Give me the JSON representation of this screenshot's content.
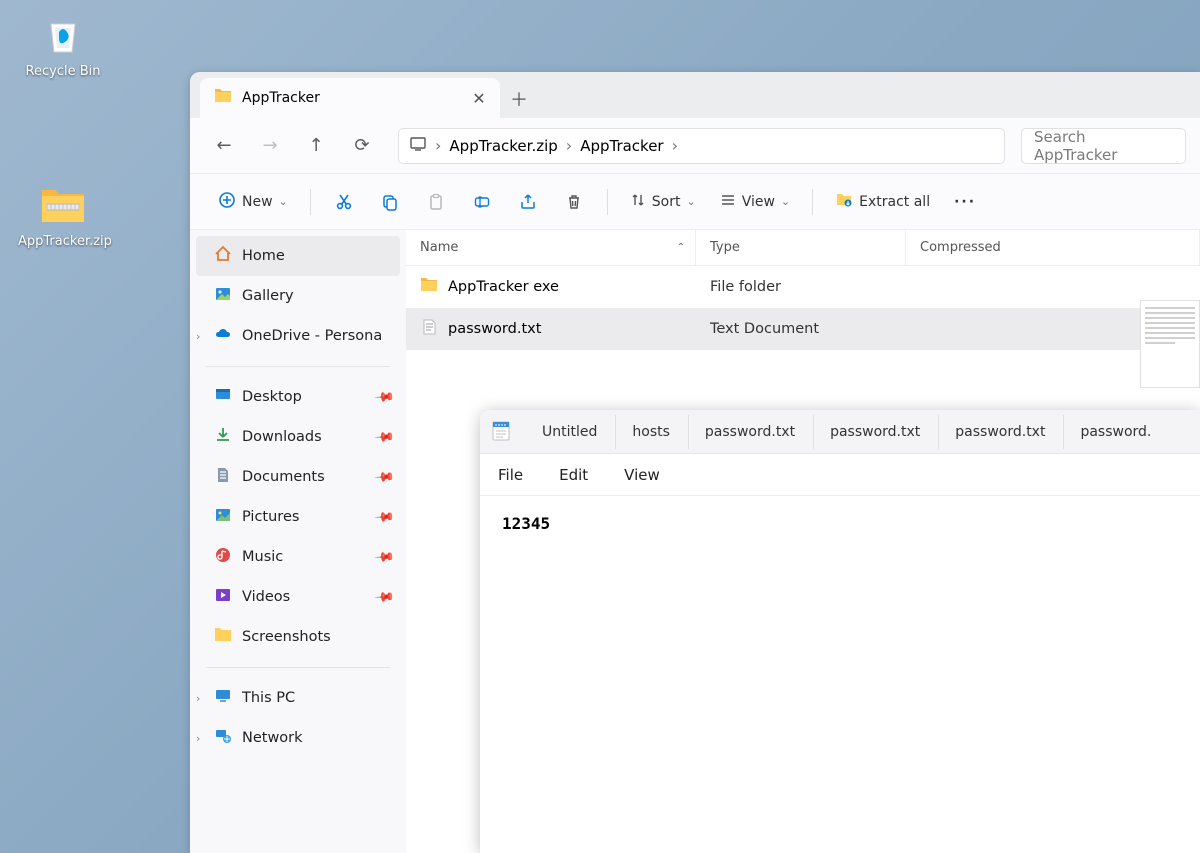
{
  "desktop": {
    "icons": [
      {
        "label": "Recycle Bin"
      },
      {
        "label": "AppTracker.zip"
      }
    ]
  },
  "explorer": {
    "tab_title": "AppTracker",
    "breadcrumb": [
      "AppTracker.zip",
      "AppTracker"
    ],
    "search_placeholder": "Search AppTracker",
    "toolbar": {
      "new": "New",
      "sort": "Sort",
      "view": "View",
      "extract": "Extract all"
    },
    "sidebar": {
      "home": "Home",
      "gallery": "Gallery",
      "onedrive": "OneDrive - Persona",
      "desktop": "Desktop",
      "downloads": "Downloads",
      "documents": "Documents",
      "pictures": "Pictures",
      "music": "Music",
      "videos": "Videos",
      "screenshots": "Screenshots",
      "thispc": "This PC",
      "network": "Network"
    },
    "columns": {
      "name": "Name",
      "type": "Type",
      "size": "Compressed"
    },
    "files": [
      {
        "name": "AppTracker exe",
        "type": "File folder"
      },
      {
        "name": "password.txt",
        "type": "Text Document"
      }
    ]
  },
  "notepad": {
    "tabs": [
      "Untitled",
      "hosts",
      "password.txt",
      "password.txt",
      "password.txt",
      "password."
    ],
    "menu": {
      "file": "File",
      "edit": "Edit",
      "view": "View"
    },
    "content": "12345"
  }
}
